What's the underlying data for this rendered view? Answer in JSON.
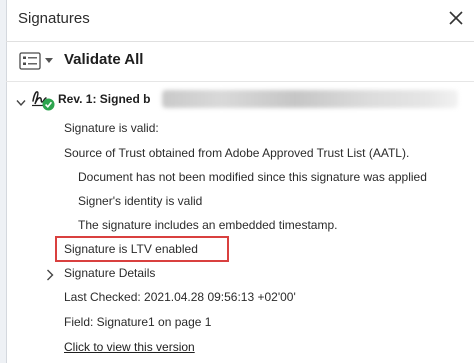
{
  "panel": {
    "title": "Signatures",
    "close_icon": "close-icon"
  },
  "toolbar": {
    "options_icon": "options-list-icon",
    "validate_all_label": "Validate All"
  },
  "revision": {
    "label": "Rev. 1: Signed b",
    "signer_icon": "signature-valid-icon",
    "expanded": true
  },
  "details": {
    "status": "Signature is valid:",
    "trust_source": "Source of Trust obtained from Adobe Approved Trust List (AATL).",
    "not_modified": "Document has not been modified since this signature was applied",
    "identity_valid": "Signer's identity is valid",
    "timestamp": "The signature includes an embedded timestamp.",
    "ltv": "Signature is LTV enabled",
    "signature_details_label": "Signature Details",
    "last_checked": "Last Checked: 2021.04.28 09:56:13 +02'00'",
    "field": "Field: Signature1 on page 1",
    "view_version_link": "Click to view this version"
  },
  "colors": {
    "highlight_border": "#d9403f",
    "valid_badge": "#2da44e"
  }
}
